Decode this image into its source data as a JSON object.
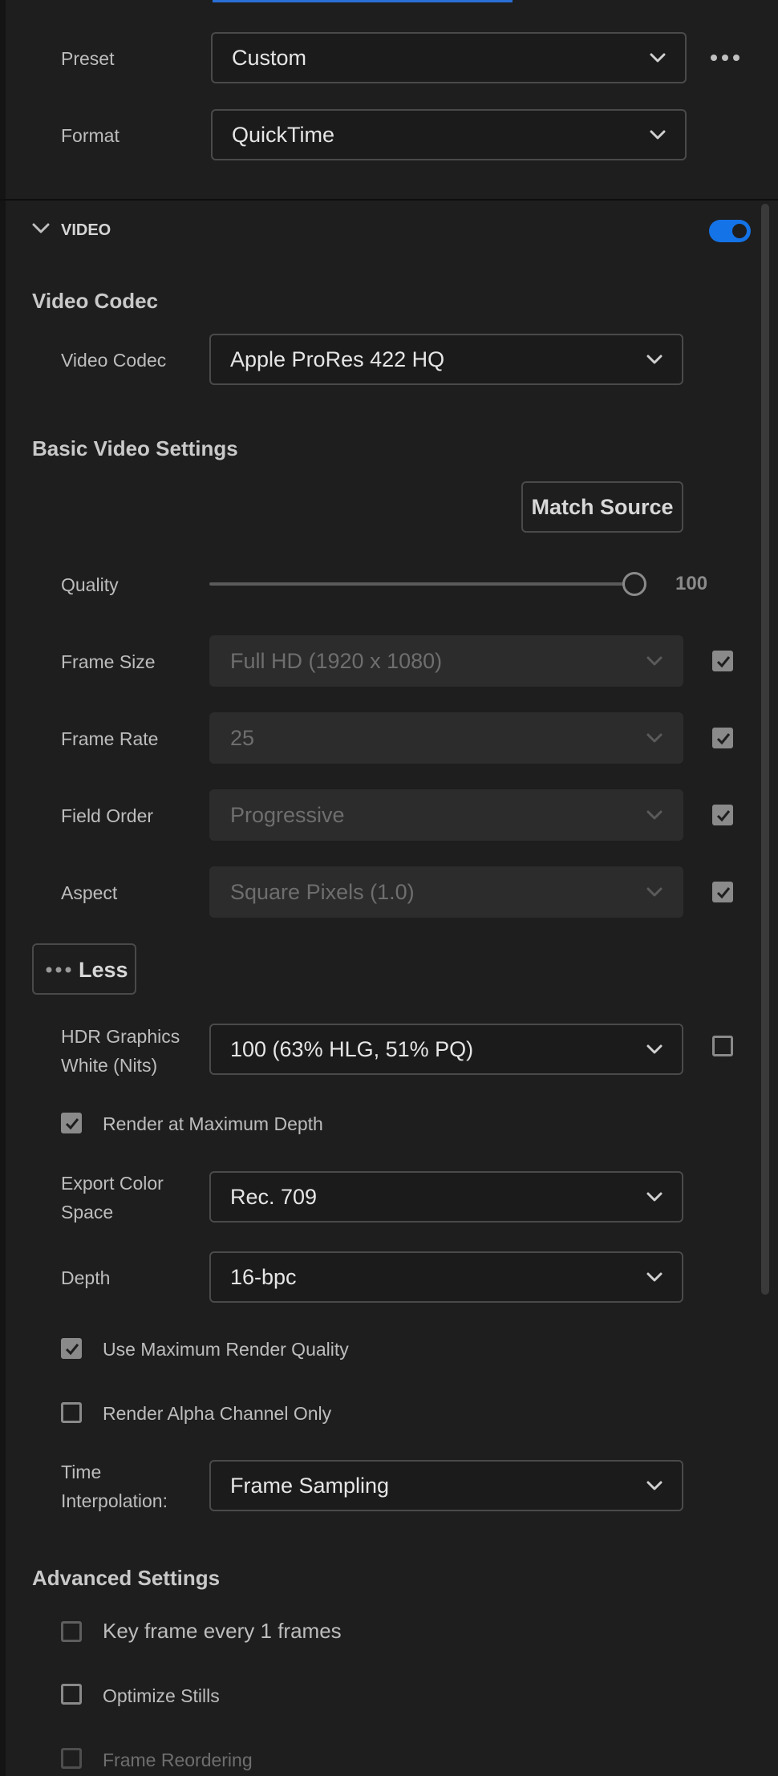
{
  "preset": {
    "label": "Preset",
    "value": "Custom"
  },
  "format": {
    "label": "Format",
    "value": "QuickTime"
  },
  "video_section": {
    "title": "VIDEO",
    "enabled": true,
    "accent": "#1473e6"
  },
  "video_codec": {
    "heading": "Video Codec",
    "label": "Video Codec",
    "value": "Apple ProRes 422 HQ"
  },
  "basic": {
    "heading": "Basic Video Settings",
    "match_source": "Match Source",
    "quality": {
      "label": "Quality",
      "value": "100",
      "level": 1.0
    },
    "frame_size": {
      "label": "Frame Size",
      "value": "Full HD (1920 x 1080)",
      "checked": true
    },
    "frame_rate": {
      "label": "Frame Rate",
      "value": "25",
      "checked": true
    },
    "field_order": {
      "label": "Field Order",
      "value": "Progressive",
      "checked": true
    },
    "aspect": {
      "label": "Aspect",
      "value": "Square Pixels (1.0)",
      "checked": true
    },
    "less_button": "Less"
  },
  "hdr": {
    "label_line1": "HDR Graphics",
    "label_line2": "White (Nits)",
    "value": "100 (63% HLG, 51% PQ)",
    "checked": false
  },
  "render_max_depth": {
    "label": "Render at Maximum Depth",
    "checked": true
  },
  "export_color_space": {
    "label_line1": "Export Color",
    "label_line2": "Space",
    "value": "Rec. 709"
  },
  "depth": {
    "label": "Depth",
    "value": "16-bpc"
  },
  "use_max_render_quality": {
    "label": "Use Maximum Render Quality",
    "checked": true
  },
  "render_alpha_only": {
    "label": "Render Alpha Channel Only",
    "checked": false
  },
  "time_interpolation": {
    "label_line1": "Time",
    "label_line2": "Interpolation:",
    "value": "Frame Sampling"
  },
  "advanced": {
    "heading": "Advanced Settings",
    "key_frame": {
      "label": "Key frame every 1 frames",
      "checked": false
    },
    "optimize_stills": {
      "label": "Optimize Stills",
      "checked": false
    },
    "frame_reordering": {
      "label": "Frame Reordering",
      "checked": false
    }
  }
}
